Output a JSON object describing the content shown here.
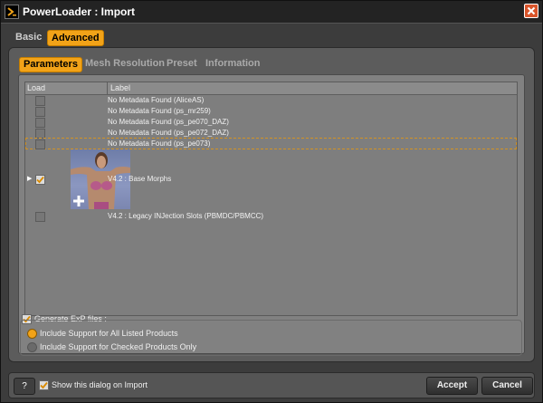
{
  "window": {
    "title": "PowerLoader : Import"
  },
  "outer_tabs": [
    {
      "label": "Basic",
      "active": false
    },
    {
      "label": "Advanced",
      "active": true
    }
  ],
  "inner_tabs": [
    {
      "label": "Parameters",
      "active": true
    },
    {
      "label": "Mesh Resolution",
      "active": false
    },
    {
      "label": "Preset",
      "active": false
    },
    {
      "label": "Information",
      "active": false
    }
  ],
  "table": {
    "columns": [
      "Load",
      "Label"
    ],
    "rows": [
      {
        "label": "No Metadata Found (AliceAS)",
        "checked": false
      },
      {
        "label": "No Metadata Found (ps_mr259)",
        "checked": false
      },
      {
        "label": "No Metadata Found (ps_pe070_DAZ)",
        "checked": false
      },
      {
        "label": "No Metadata Found (ps_pe072_DAZ)",
        "checked": false
      },
      {
        "label": "No Metadata Found (ps_pe073)",
        "checked": false
      },
      {
        "label": "V4.2 : Base Morphs",
        "checked": true
      },
      {
        "label": "V4.2 : Legacy INJection Slots (PBMDC/PBMCC)",
        "checked": false
      }
    ]
  },
  "options": {
    "generate_label": "Generate ExP files :",
    "generate_checked": true,
    "radio_all": "Include Support for All Listed Products",
    "radio_checked": "Include Support for Checked Products Only",
    "selected": "all"
  },
  "footer": {
    "help_label": "?",
    "show_dialog_label": "Show this dialog on Import",
    "show_dialog_checked": true,
    "accept_label": "Accept",
    "cancel_label": "Cancel"
  },
  "colors": {
    "accent": "#f2a318",
    "panel": "#818181",
    "background": "#3c3c3c"
  }
}
